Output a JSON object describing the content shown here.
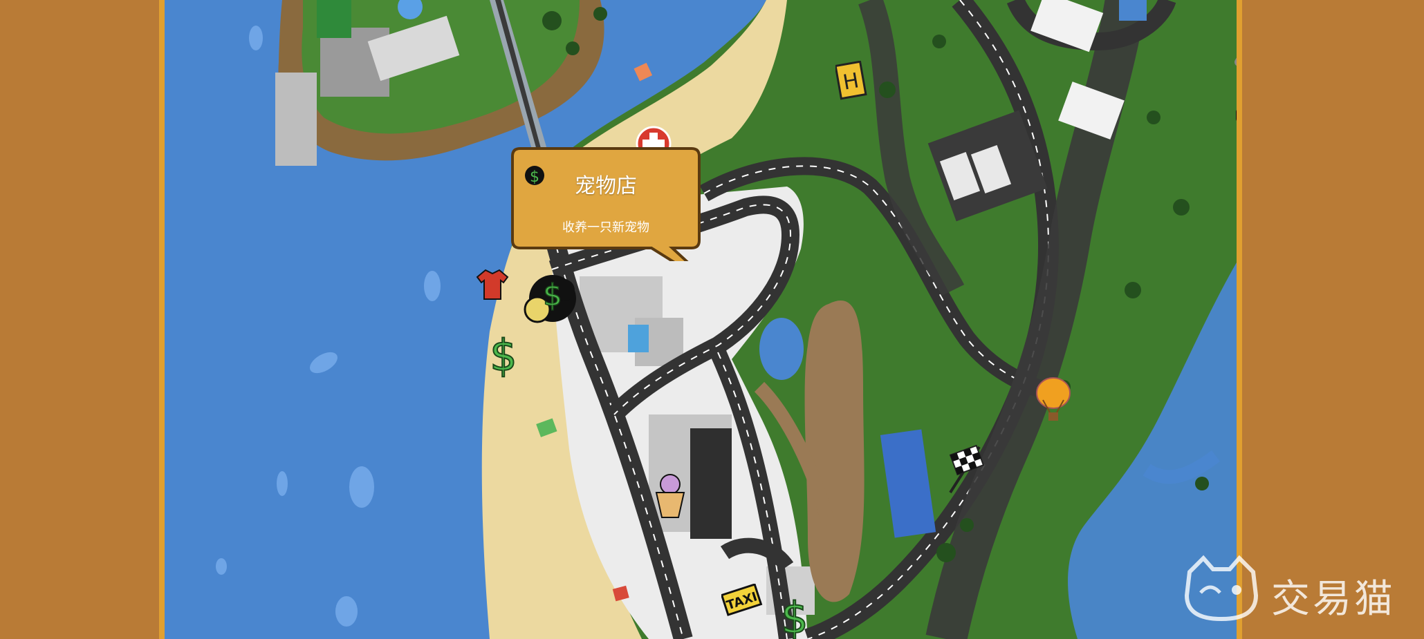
{
  "callout": {
    "title": "宠物店",
    "description": "收养一只新宠物",
    "icon": "paw-icon"
  },
  "map_markers": [
    {
      "name": "pet-shop-paw-icon",
      "type": "paw"
    },
    {
      "name": "clothes-shop-shirt-icon",
      "type": "shirt"
    },
    {
      "name": "money-icon",
      "type": "dollar"
    },
    {
      "name": "hospital-cross-icon",
      "type": "cross"
    },
    {
      "name": "helipad-h-icon",
      "type": "helipad"
    },
    {
      "name": "repair-wrench-icon",
      "type": "wrench"
    },
    {
      "name": "car-dealer-icon",
      "type": "car"
    },
    {
      "name": "hot-air-balloon-icon",
      "type": "balloon"
    },
    {
      "name": "race-checkered-flag-icon",
      "type": "flag"
    },
    {
      "name": "ice-cream-shop-icon",
      "type": "icecream"
    },
    {
      "name": "taxi-sign-icon",
      "type": "taxi"
    }
  ],
  "taxi_label": "TAXI",
  "watermark": {
    "text": "交易猫",
    "icon": "cat-face-icon"
  },
  "colors": {
    "frame": "#b97b36",
    "water": "#4a86cf",
    "sand": "#ecd9a0",
    "grass": "#3e7a2c",
    "road": "#3a3a3a",
    "callout": "#e0a640"
  }
}
